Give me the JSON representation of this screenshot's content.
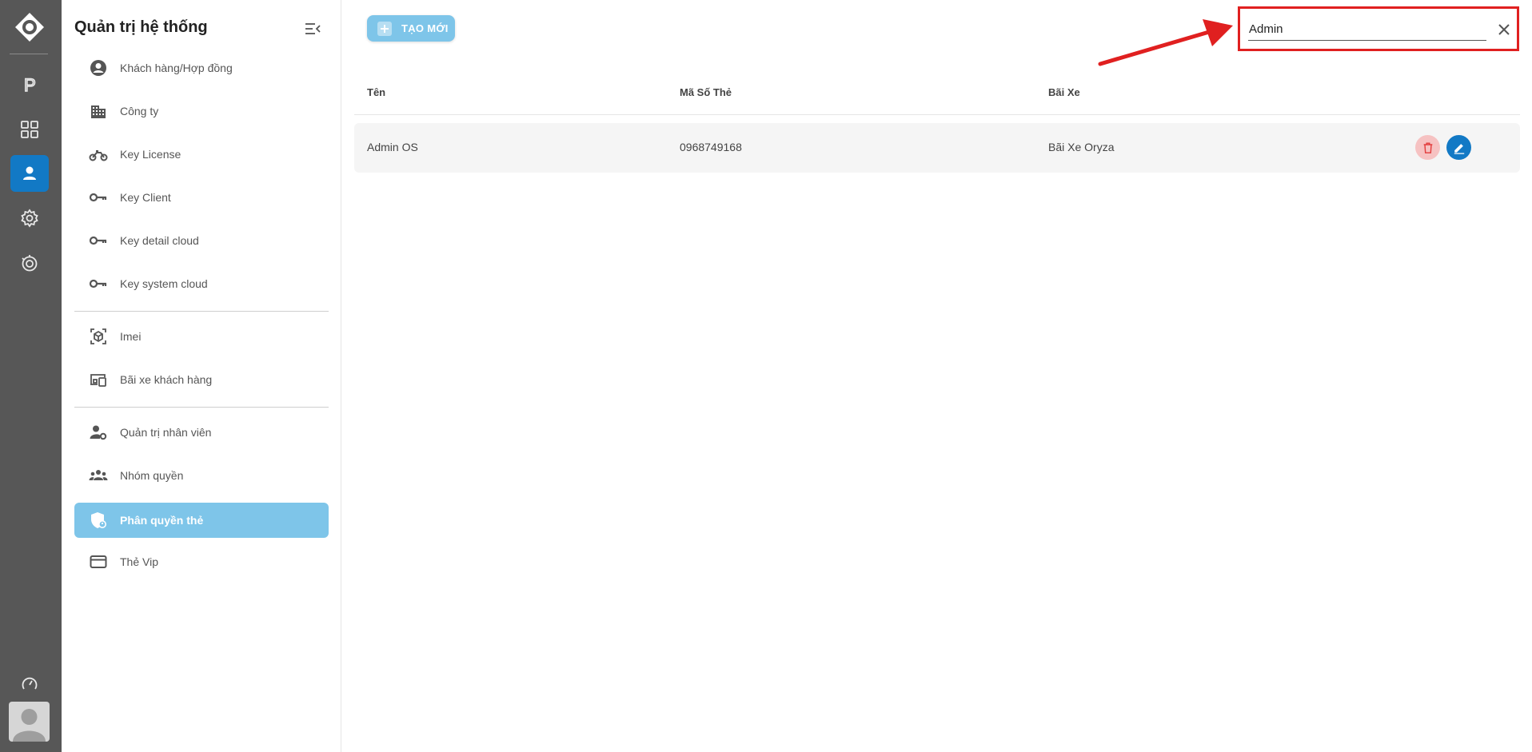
{
  "sidebar": {
    "title": "Quản trị hệ thống",
    "items": [
      {
        "label": "Khách hàng/Hợp đồng",
        "icon": "account-circle-icon"
      },
      {
        "label": "Công ty",
        "icon": "building-icon"
      },
      {
        "label": "Key License",
        "icon": "motorbike-icon"
      },
      {
        "label": "Key Client",
        "icon": "key-icon"
      },
      {
        "label": "Key detail cloud",
        "icon": "key-icon"
      },
      {
        "label": "Key system cloud",
        "icon": "key-icon"
      },
      {
        "label": "Imei",
        "icon": "scan-box-icon"
      },
      {
        "label": "Bãi xe khách hàng",
        "icon": "devices-icon"
      },
      {
        "label": "Quản trị nhân viên",
        "icon": "user-gear-icon"
      },
      {
        "label": "Nhóm quyền",
        "icon": "group-icon"
      },
      {
        "label": "Phân quyền thẻ",
        "icon": "shield-icon"
      },
      {
        "label": "Thẻ Vip",
        "icon": "card-icon"
      }
    ]
  },
  "toolbar": {
    "create_label": "TẠO MỚI"
  },
  "search": {
    "value": "Admin",
    "placeholder": ""
  },
  "table": {
    "columns": [
      "Tên",
      "Mã Số Thẻ",
      "Bãi Xe"
    ],
    "rows": [
      {
        "name": "Admin OS",
        "card_number": "0968749168",
        "parking_lot": "Bãi Xe Oryza"
      }
    ]
  },
  "colors": {
    "rail_bg": "#575757",
    "accent": "#1279c5",
    "active_item": "#7ec5e9",
    "annotation_red": "#e02020"
  }
}
